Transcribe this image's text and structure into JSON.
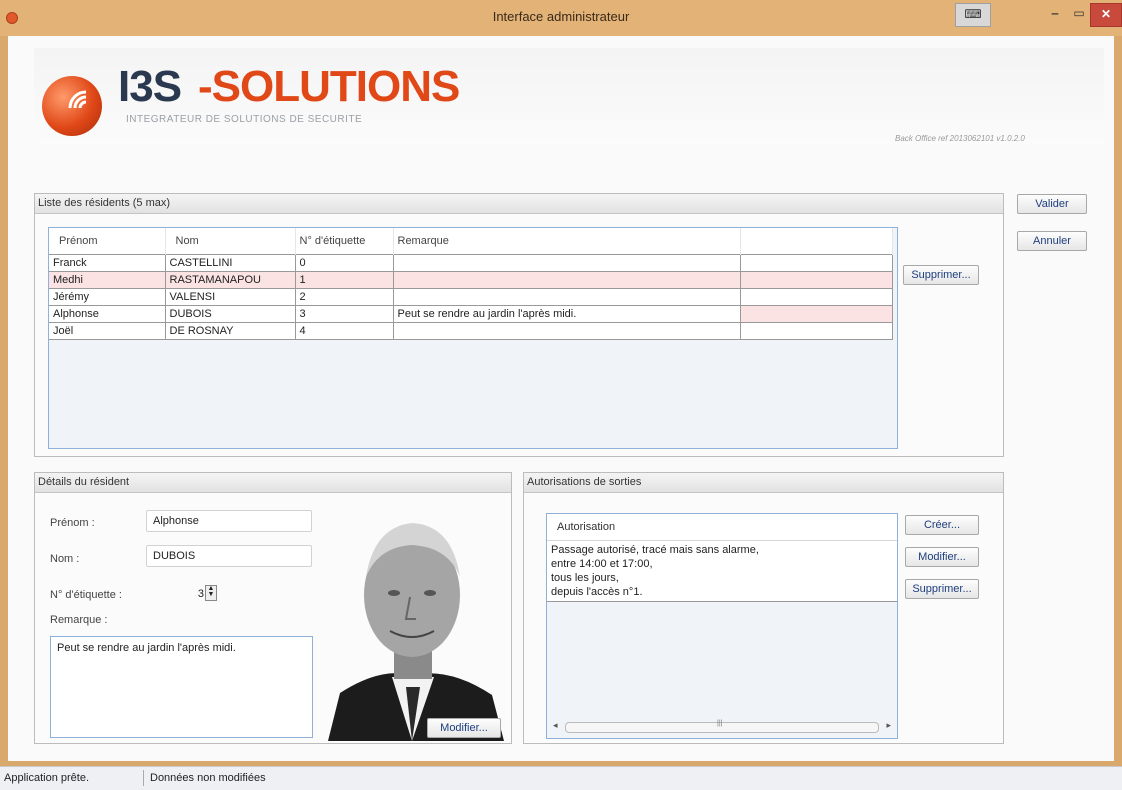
{
  "window": {
    "title": "Interface administrateur"
  },
  "logo": {
    "brand_a": "I3S",
    "brand_b": "-SOLUTIONS",
    "tagline": "INTEGRATEUR DE SOLUTIONS DE SECURITE"
  },
  "version": "Back Office ref 2013062101 v1.0.2.0",
  "actions": {
    "validate": "Valider",
    "cancel": "Annuler"
  },
  "residents": {
    "title": "Liste des résidents (5 max)",
    "columns": [
      "Prénom",
      "Nom",
      "N° d'étiquette",
      "Remarque"
    ],
    "rows": [
      {
        "prenom": "Franck",
        "nom": "CASTELLINI",
        "tag": "0",
        "remarque": ""
      },
      {
        "prenom": "Medhi",
        "nom": "RASTAMANAPOU",
        "tag": "1",
        "remarque": ""
      },
      {
        "prenom": "Jérémy",
        "nom": "VALENSI",
        "tag": "2",
        "remarque": ""
      },
      {
        "prenom": "Alphonse",
        "nom": "DUBOIS",
        "tag": "3",
        "remarque": "Peut se rendre au jardin l'après midi."
      },
      {
        "prenom": "Joël",
        "nom": "DE ROSNAY",
        "tag": "4",
        "remarque": ""
      }
    ],
    "delete_label": "Supprimer..."
  },
  "details": {
    "title": "Détails du résident",
    "prenom_label": "Prénom :",
    "prenom_value": "Alphonse",
    "nom_label": "Nom :",
    "nom_value": "DUBOIS",
    "tag_label": "N° d'étiquette :",
    "tag_value": "3",
    "remarque_label": "Remarque :",
    "remarque_value": "Peut se rendre au jardin l'après midi.",
    "modify_photo_label": "Modifier..."
  },
  "authorizations": {
    "title": "Autorisations de sorties",
    "column": "Autorisation",
    "entry_lines": [
      "Passage autorisé, tracé mais sans alarme,",
      "entre 14:00 et 17:00,",
      "tous les jours,",
      "depuis l'accès n°1."
    ],
    "create_label": "Créer...",
    "modify_label": "Modifier...",
    "delete_label": "Supprimer...",
    "scroll_left": "◂",
    "scroll_right": "▸",
    "scroll_grip": "|||"
  },
  "status": {
    "ready": "Application prête.",
    "state": "Données non modifiées"
  },
  "colors": {
    "title_bar": "#e3b277",
    "brand_orange": "#e04818",
    "brand_navy": "#2b3950",
    "highlight_row": "#fbe3e3",
    "close_button": "#c84a3c"
  }
}
